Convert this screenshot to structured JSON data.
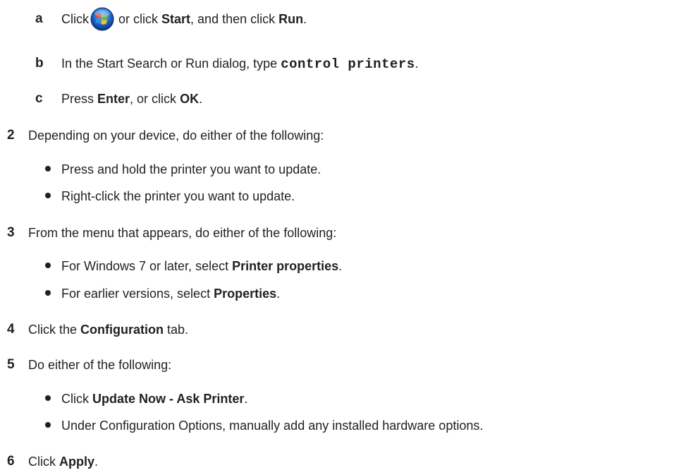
{
  "substeps": [
    {
      "marker": "a",
      "pre": "Click",
      "icon": "windows-start-orb-icon",
      "mid1": "or click",
      "bold1": "Start",
      "mid2": ", and then click",
      "bold2": "Run",
      "end": "."
    },
    {
      "marker": "b",
      "pre": "In the Start Search or Run dialog, type",
      "code": "control printers",
      "end": "."
    },
    {
      "marker": "c",
      "pre": "Press",
      "bold1": "Enter",
      "mid": ", or click",
      "bold2": "OK",
      "end": "."
    }
  ],
  "steps": [
    {
      "number": "2",
      "text": "Depending on your device, do either of the following:",
      "bullets": [
        {
          "text": "Press and hold the printer you want to update."
        },
        {
          "text": "Right-click the printer you want to update."
        }
      ]
    },
    {
      "number": "3",
      "text": "From the menu that appears, do either of the following:",
      "bullets": [
        {
          "pre": "For Windows 7 or later, select",
          "bold": "Printer properties",
          "end": "."
        },
        {
          "pre": "For earlier versions, select",
          "bold": "Properties",
          "end": "."
        }
      ]
    },
    {
      "number": "4",
      "pre": "Click the",
      "bold": "Configuration",
      "end": "tab."
    },
    {
      "number": "5",
      "text": "Do either of the following:",
      "bullets": [
        {
          "pre": "Click",
          "bold": "Update Now - Ask Printer",
          "end": "."
        },
        {
          "text": "Under Configuration Options, manually add any installed hardware options."
        }
      ]
    },
    {
      "number": "6",
      "pre": "Click",
      "bold": "Apply",
      "end": "."
    }
  ],
  "colors": {
    "text": "#231f20",
    "orb_blue": "#1e63c6",
    "flag_red": "#e8482c",
    "flag_green": "#6cbd45",
    "flag_blue": "#2f8fe0",
    "flag_yellow": "#f7c32a"
  }
}
